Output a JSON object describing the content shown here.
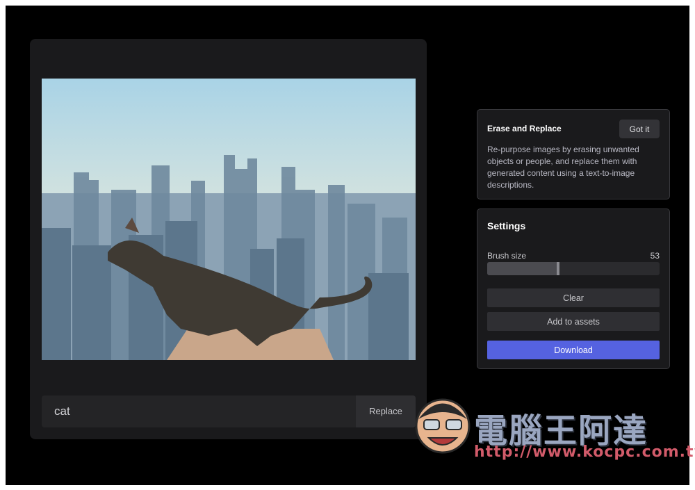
{
  "prompt": {
    "value": "cat",
    "replace_label": "Replace"
  },
  "info": {
    "title": "Erase and Replace",
    "dismiss_label": "Got it",
    "description": "Re-purpose images by erasing unwanted objects or people, and replace them with generated content using a text-to-image descriptions."
  },
  "settings": {
    "title": "Settings",
    "brush_label": "Brush size",
    "brush_value": "53",
    "brush_fraction": 0.41,
    "clear_label": "Clear",
    "add_assets_label": "Add to assets",
    "download_label": "Download"
  },
  "colors": {
    "accent": "#5562e0",
    "panel": "#1a1a1c",
    "background": "#000000"
  },
  "watermark": {
    "text": "電腦王阿達",
    "url": "http://www.kocpc.com.tw"
  }
}
